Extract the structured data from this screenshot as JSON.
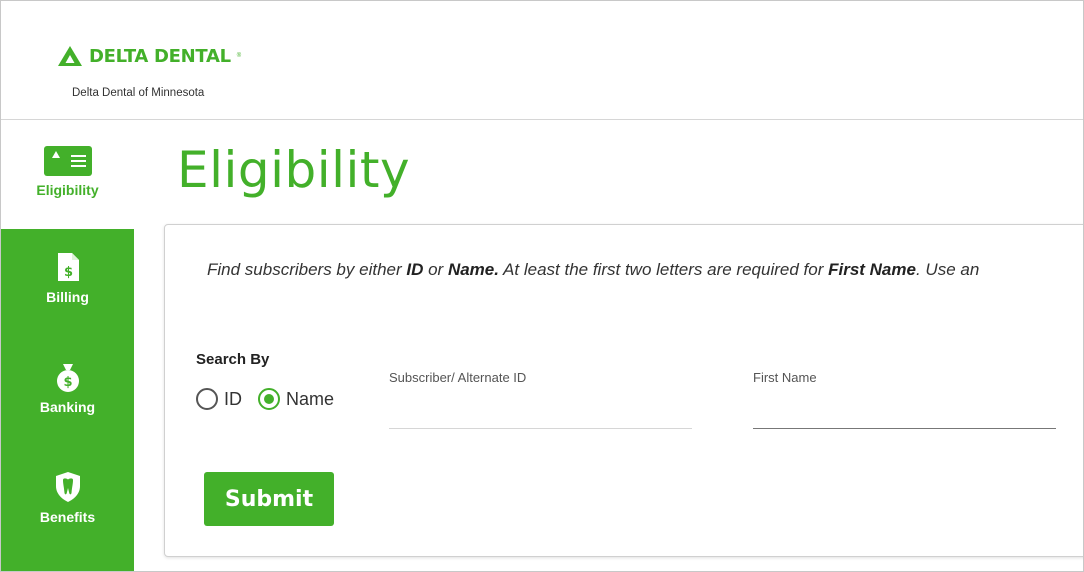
{
  "header": {
    "brand": "DELTA DENTAL",
    "org_name": "Delta Dental of Minnesota"
  },
  "sidebar": {
    "items": [
      {
        "label": "Eligibility",
        "icon": "eligibility-card-icon",
        "active": true
      },
      {
        "label": "Billing",
        "icon": "billing-document-icon",
        "active": false
      },
      {
        "label": "Banking",
        "icon": "money-bag-icon",
        "active": false
      },
      {
        "label": "Benefits",
        "icon": "tooth-shield-icon",
        "active": false
      }
    ]
  },
  "main": {
    "title": "Eligibility",
    "instructions": {
      "t1": "Find subscribers by either ",
      "b1": "ID",
      "t2": " or ",
      "b2": "Name.",
      "t3": " At least the first two letters are required for ",
      "b3": "First Name",
      "t4": ". Use an"
    },
    "search_by_label": "Search By",
    "radio_options": [
      {
        "label": "ID",
        "checked": false
      },
      {
        "label": "Name",
        "checked": true
      }
    ],
    "fields": {
      "subscriber_id_label": "Subscriber/ Alternate ID",
      "subscriber_id_value": "",
      "first_name_label": "First Name",
      "first_name_value": ""
    },
    "submit_label": "Submit"
  },
  "colors": {
    "brand_green": "#43b02a"
  }
}
